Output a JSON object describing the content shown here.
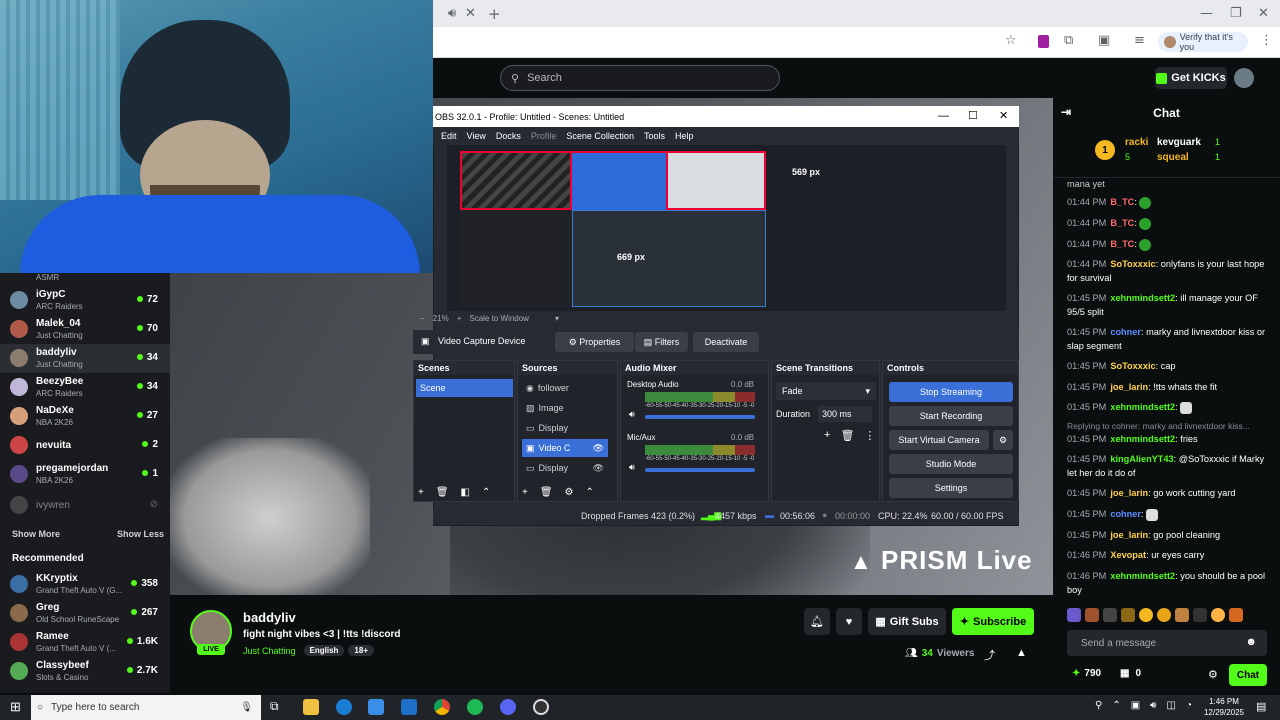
{
  "browser": {
    "verify_label": "Verify that it's you",
    "icons": [
      "mute-icon",
      "new-tab-icon",
      "bookmark-star-icon",
      "extensions-icon",
      "menu-icon"
    ]
  },
  "kick": {
    "search_placeholder": "Search",
    "get_kicks": "Get KICKs"
  },
  "sidebar": {
    "top_category": "ASMR",
    "following": [
      {
        "name": "iGypC",
        "category": "ARC Raiders",
        "viewers": "72",
        "color": "#6b8ca3"
      },
      {
        "name": "Malek_04",
        "category": "Just Chatting",
        "viewers": "70",
        "color": "#b05a4a"
      },
      {
        "name": "baddyliv",
        "category": "Just Chatting",
        "viewers": "34",
        "color": "#8b7d6e"
      },
      {
        "name": "BeezyBee",
        "category": "ARC Raiders",
        "viewers": "34",
        "color": "#c0b7d8"
      },
      {
        "name": "NaDeXe",
        "category": "NBA 2K26",
        "viewers": "27",
        "color": "#d7a07a"
      },
      {
        "name": "nevuita",
        "category": "",
        "viewers": "2",
        "color": "#c44"
      },
      {
        "name": "pregamejordan",
        "category": "NBA 2K26",
        "viewers": "1",
        "color": "#5a4a8a"
      },
      {
        "name": "ivywren",
        "category": "",
        "viewers": "",
        "color": "#777"
      }
    ],
    "show_more": "Show More",
    "show_less": "Show Less",
    "recommended_title": "Recommended",
    "recommended": [
      {
        "name": "KKryptix",
        "category": "Grand Theft Auto V (G...",
        "viewers": "358",
        "color": "#3a6ea5"
      },
      {
        "name": "Greg",
        "category": "Old School RuneScape",
        "viewers": "267",
        "color": "#8a6a4a"
      },
      {
        "name": "Ramee",
        "category": "Grand Theft Auto V (...",
        "viewers": "1.6K",
        "color": "#a33"
      },
      {
        "name": "Classybeef",
        "category": "Slots & Casino",
        "viewers": "2.7K",
        "color": "#5a5"
      }
    ]
  },
  "obs": {
    "title": "OBS 32.0.1 - Profile: Untitled - Scenes: Untitled",
    "menu": [
      "Edit",
      "View",
      "Docks",
      "Profile",
      "Scene Collection",
      "Tools",
      "Help"
    ],
    "px_label_1": "569 px",
    "px_label_2": "669 px",
    "zoom": "21%",
    "scale_label": "Scale to Window",
    "source_name": "Video Capture Device",
    "properties": "Properties",
    "filters": "Filters",
    "deactivate": "Deactivate",
    "panels": {
      "scenes": "Scenes",
      "sources": "Sources",
      "audio_mixer": "Audio Mixer",
      "scene_transitions": "Scene Transitions",
      "controls": "Controls"
    },
    "scene_item": "Scene",
    "sources_list": [
      "follower",
      "Image",
      "Display",
      "Video C",
      "Display"
    ],
    "audio": [
      {
        "name": "Desktop Audio",
        "db": "0.0 dB"
      },
      {
        "name": "Mic/Aux",
        "db": "0.0 dB"
      }
    ],
    "meter_scale": "-60-55-50-45-40-35-30-25-20-15-10 -5 -0",
    "transition": "Fade",
    "duration_label": "Duration",
    "duration_value": "300 ms",
    "controls": [
      "Stop Streaming",
      "Start Recording",
      "Start Virtual Camera",
      "Studio Mode",
      "Settings"
    ],
    "status": {
      "dropped": "Dropped Frames 423 (0.2%)",
      "kbps": "4457 kbps",
      "stream_time": "00:56:06",
      "rec_time": "00:00:00",
      "cpu": "CPU: 22.4%",
      "fps": "60.00 / 60.00 FPS"
    }
  },
  "stream": {
    "overlay_brand": "PRISM Live"
  },
  "chat": {
    "title": "Chat",
    "pinned": [
      {
        "name": "racki",
        "count": "5"
      },
      {
        "name": "kevguark",
        "count": "1"
      },
      {
        "name": "squeal",
        "count": "1"
      }
    ],
    "partial_line": "mana yet",
    "messages": [
      {
        "time": "01:44 PM",
        "user": "B_TC",
        "color": "#ff6b6b",
        "text": ""
      },
      {
        "time": "01:44 PM",
        "user": "B_TC",
        "color": "#ff6b6b",
        "text": ""
      },
      {
        "time": "01:44 PM",
        "user": "B_TC",
        "color": "#ff6b6b",
        "text": ""
      },
      {
        "time": "01:44 PM",
        "user": "SoToxxxic",
        "color": "#ffd24d",
        "text": "onlyfans is your last hope for survival"
      },
      {
        "time": "01:45 PM",
        "user": "xehnmindsett2",
        "color": "#53fc18",
        "text": "ill manage your OF 95/5 split"
      },
      {
        "time": "01:45 PM",
        "user": "cohner",
        "color": "#5b8cff",
        "text": "marky and livnextdoor kiss or slap segment"
      },
      {
        "time": "01:45 PM",
        "user": "SoToxxxic",
        "color": "#ffd24d",
        "text": "cap"
      },
      {
        "time": "01:45 PM",
        "user": "joe_larin",
        "color": "#ffd24d",
        "text": "!tts whats the fit"
      },
      {
        "time": "01:45 PM",
        "user": "xehnmindsett2",
        "color": "#53fc18",
        "text": ""
      },
      {
        "time": "01:45 PM",
        "user": "xehnmindsett2",
        "color": "#53fc18",
        "text": "fries"
      },
      {
        "time": "01:45 PM",
        "user": "kingAlienYT43",
        "color": "#53fc18",
        "text": "@SoToxxxic if Marky let her do it do of"
      },
      {
        "time": "01:45 PM",
        "user": "joe_larin",
        "color": "#ffd24d",
        "text": "go work cutting yard"
      },
      {
        "time": "01:45 PM",
        "user": "cohner",
        "color": "#5b8cff",
        "text": ""
      },
      {
        "time": "01:45 PM",
        "user": "joe_larin",
        "color": "#ffd24d",
        "text": "go pool cleaning"
      },
      {
        "time": "01:46 PM",
        "user": "Xevopat",
        "color": "#ffd24d",
        "text": "ur eyes carry"
      },
      {
        "time": "01:46 PM",
        "user": "xehnmindsett2",
        "color": "#53fc18",
        "text": "you should be a pool boy"
      }
    ],
    "reply_note": "Replying to cohner: marky and livnextdoor kiss...",
    "input_placeholder": "Send a message",
    "points": "790",
    "gifts": "0",
    "chat_button": "Chat"
  },
  "streamer": {
    "name": "baddyliv",
    "title": "fight night vibes <3 | !tts !discord",
    "category": "Just Chatting",
    "tags": [
      "English",
      "18+"
    ],
    "live": "LIVE",
    "viewers": "34",
    "viewers_label": "Viewers",
    "gift_subs": "Gift Subs",
    "subscribe": "Subscribe"
  },
  "taskbar": {
    "search": "Type here to search",
    "time": "1:46 PM",
    "date": "12/29/2025"
  }
}
